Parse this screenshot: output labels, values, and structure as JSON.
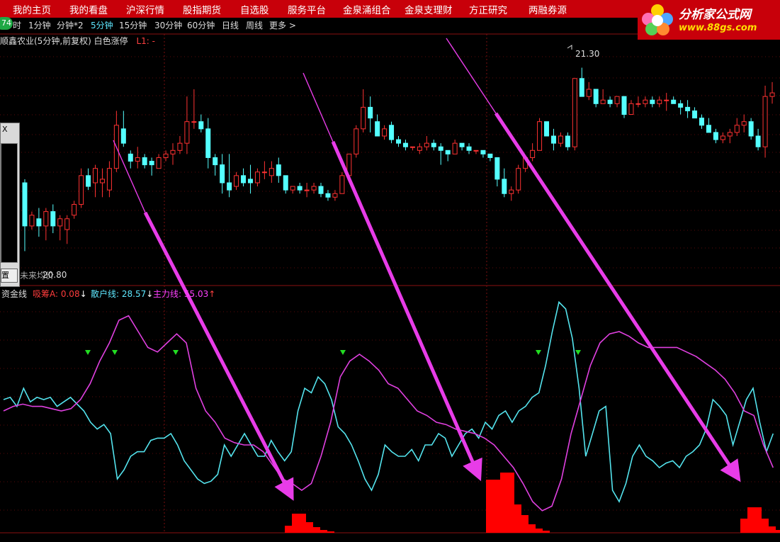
{
  "topnav": {
    "items": [
      "我的主页",
      "我的看盘",
      "沪深行情",
      "股指期货",
      "自选股",
      "服务平台",
      "金泉涌组合",
      "金泉支理财",
      "方正研究",
      "两融券源"
    ]
  },
  "logo": {
    "title": "分析家公式网",
    "url_text": "www.88gs.com"
  },
  "badge": "74",
  "periods": [
    "时",
    "1分钟",
    "分钟*2",
    "5分钟",
    "15分钟",
    "30分钟",
    "60分钟",
    "日线",
    "周线",
    "更多 >"
  ],
  "active_period": "5分钟",
  "stock": {
    "title": "顺鑫农业(5分钟,前复权) 白色涨停",
    "l1": "L1: -",
    "high_label": "21.30",
    "low_label": "20.80",
    "low_prefix": "未来均价"
  },
  "sidepanel": {
    "close": "X",
    "button": "置"
  },
  "indicator": {
    "name": "资金线",
    "items": [
      {
        "label": "吸筹A: 0.08",
        "arrow": "↓",
        "color": "#ff3c3c"
      },
      {
        "label": "散户线: 28.57",
        "arrow": "↓",
        "color": "#5ee8ff"
      },
      {
        "label": "主力线: 55.03",
        "arrow": "↑",
        "color": "#ff40ff"
      }
    ]
  },
  "colors": {
    "up": "#ff3232",
    "down": "#54ffff",
    "main": "#e040e0",
    "retail": "#54e4ee",
    "bars": "#ff0000",
    "arrow": "#e83ce8",
    "signal": "#22dd22"
  },
  "chart_data": [
    {
      "type": "candlestick",
      "title": "顺鑫农业(5分钟,前复权)",
      "ylim": [
        20.72,
        21.37
      ],
      "markers": {
        "high": 21.3,
        "low": 20.8
      },
      "candles": [
        [
          20.98,
          20.86,
          20.79,
          20.99
        ],
        [
          20.86,
          20.89,
          20.85,
          20.9
        ],
        [
          20.88,
          20.86,
          20.83,
          20.91
        ],
        [
          20.86,
          20.9,
          20.82,
          20.91
        ],
        [
          20.9,
          20.86,
          20.84,
          20.92
        ],
        [
          20.86,
          20.88,
          20.82,
          20.89
        ],
        [
          20.85,
          20.88,
          20.81,
          20.89
        ],
        [
          20.89,
          20.92,
          20.88,
          20.93
        ],
        [
          20.92,
          21.0,
          20.91,
          21.02
        ],
        [
          21.0,
          20.97,
          20.96,
          21.02
        ],
        [
          20.98,
          21.02,
          20.94,
          21.03
        ],
        [
          20.98,
          20.99,
          20.94,
          21.02
        ],
        [
          20.96,
          21.02,
          20.94,
          21.04
        ],
        [
          21.02,
          21.14,
          21.01,
          21.18
        ],
        [
          21.13,
          21.09,
          21.08,
          21.18
        ],
        [
          21.06,
          21.04,
          21.02,
          21.07
        ],
        [
          21.04,
          21.05,
          21.02,
          21.08
        ],
        [
          21.05,
          21.03,
          21.02,
          21.06
        ],
        [
          21.04,
          21.03,
          21.0,
          21.05
        ],
        [
          21.02,
          21.05,
          21.02,
          21.06
        ],
        [
          21.05,
          21.06,
          21.04,
          21.07
        ],
        [
          21.06,
          21.07,
          21.03,
          21.09
        ],
        [
          21.07,
          21.09,
          21.06,
          21.11
        ],
        [
          21.09,
          21.15,
          21.06,
          21.22
        ],
        [
          21.15,
          21.15,
          21.13,
          21.24
        ],
        [
          21.15,
          21.13,
          21.12,
          21.17
        ],
        [
          21.13,
          21.05,
          21.02,
          21.16
        ],
        [
          21.05,
          21.03,
          21.0,
          21.06
        ],
        [
          21.03,
          20.98,
          20.95,
          21.06
        ],
        [
          20.98,
          20.96,
          20.94,
          21.06
        ],
        [
          20.97,
          21.0,
          20.96,
          21.01
        ],
        [
          21.0,
          20.98,
          20.97,
          21.02
        ],
        [
          20.99,
          20.98,
          20.95,
          21.03
        ],
        [
          20.98,
          21.01,
          20.97,
          21.02
        ],
        [
          21.01,
          21.01,
          20.99,
          21.04
        ],
        [
          21.0,
          21.02,
          20.98,
          21.04
        ],
        [
          21.03,
          21.0,
          20.98,
          21.05
        ],
        [
          21.0,
          20.96,
          20.95,
          21.0
        ],
        [
          20.96,
          20.97,
          20.95,
          20.97
        ],
        [
          20.97,
          20.96,
          20.95,
          20.98
        ],
        [
          20.96,
          20.96,
          20.94,
          20.98
        ],
        [
          20.96,
          20.97,
          20.95,
          20.98
        ],
        [
          20.97,
          20.95,
          20.94,
          20.98
        ],
        [
          20.95,
          20.94,
          20.93,
          20.96
        ],
        [
          20.94,
          20.95,
          20.93,
          20.96
        ],
        [
          20.95,
          21.0,
          20.95,
          21.01
        ],
        [
          21.0,
          21.06,
          20.99,
          21.06
        ],
        [
          21.06,
          21.13,
          21.05,
          21.14
        ],
        [
          21.13,
          21.19,
          21.12,
          21.24
        ],
        [
          21.19,
          21.16,
          21.12,
          21.22
        ],
        [
          21.15,
          21.11,
          21.11,
          21.17
        ],
        [
          21.11,
          21.13,
          21.1,
          21.14
        ],
        [
          21.14,
          21.1,
          21.09,
          21.15
        ],
        [
          21.1,
          21.09,
          21.08,
          21.11
        ],
        [
          21.09,
          21.08,
          21.07,
          21.1
        ],
        [
          21.08,
          21.08,
          21.07,
          21.08
        ],
        [
          21.07,
          21.08,
          21.06,
          21.09
        ],
        [
          21.08,
          21.09,
          21.07,
          21.11
        ],
        [
          21.09,
          21.08,
          21.07,
          21.1
        ],
        [
          21.08,
          21.07,
          21.03,
          21.09
        ],
        [
          21.07,
          21.06,
          21.04,
          21.07
        ],
        [
          21.06,
          21.09,
          21.06,
          21.1
        ],
        [
          21.09,
          21.08,
          21.07,
          21.09
        ],
        [
          21.08,
          21.07,
          21.06,
          21.09
        ],
        [
          21.07,
          21.07,
          21.06,
          21.07
        ],
        [
          21.07,
          21.06,
          21.05,
          21.07
        ],
        [
          21.06,
          21.05,
          21.04,
          21.06
        ],
        [
          21.05,
          20.99,
          20.97,
          21.05
        ],
        [
          20.99,
          20.95,
          20.94,
          21.02
        ],
        [
          20.95,
          20.96,
          20.93,
          20.97
        ],
        [
          20.96,
          21.02,
          20.95,
          21.03
        ],
        [
          21.02,
          21.05,
          21.01,
          21.05
        ],
        [
          21.05,
          21.07,
          21.04,
          21.09
        ],
        [
          21.07,
          21.15,
          21.07,
          21.16
        ],
        [
          21.15,
          21.11,
          21.11,
          21.15
        ],
        [
          21.11,
          21.09,
          21.07,
          21.13
        ],
        [
          21.09,
          21.11,
          21.08,
          21.12
        ],
        [
          21.11,
          21.08,
          21.07,
          21.12
        ],
        [
          21.08,
          21.27,
          21.07,
          21.27
        ],
        [
          21.27,
          21.22,
          21.22,
          21.3
        ],
        [
          21.22,
          21.24,
          21.21,
          21.26
        ],
        [
          21.24,
          21.2,
          21.19,
          21.24
        ],
        [
          21.2,
          21.21,
          21.2,
          21.24
        ],
        [
          21.21,
          21.2,
          21.19,
          21.22
        ],
        [
          21.2,
          21.22,
          21.19,
          21.22
        ],
        [
          21.22,
          21.17,
          21.16,
          21.21
        ],
        [
          21.17,
          21.2,
          21.17,
          21.21
        ],
        [
          21.2,
          21.2,
          21.19,
          21.22
        ],
        [
          21.2,
          21.21,
          21.19,
          21.22
        ],
        [
          21.21,
          21.2,
          21.19,
          21.22
        ],
        [
          21.2,
          21.21,
          21.19,
          21.22
        ],
        [
          21.21,
          21.21,
          21.18,
          21.23
        ],
        [
          21.21,
          21.2,
          21.2,
          21.22
        ],
        [
          21.2,
          21.19,
          21.17,
          21.21
        ],
        [
          21.19,
          21.18,
          21.16,
          21.21
        ],
        [
          21.18,
          21.16,
          21.16,
          21.19
        ],
        [
          21.16,
          21.14,
          21.13,
          21.17
        ],
        [
          21.14,
          21.12,
          21.12,
          21.16
        ],
        [
          21.12,
          21.1,
          21.09,
          21.13
        ],
        [
          21.1,
          21.11,
          21.09,
          21.12
        ],
        [
          21.11,
          21.12,
          21.09,
          21.13
        ],
        [
          21.12,
          21.14,
          21.11,
          21.16
        ],
        [
          21.14,
          21.15,
          21.12,
          21.17
        ],
        [
          21.15,
          21.11,
          21.1,
          21.16
        ],
        [
          21.11,
          21.08,
          21.07,
          21.13
        ],
        [
          21.08,
          21.22,
          21.05,
          21.25
        ],
        [
          21.22,
          21.23,
          21.2,
          21.26
        ]
      ]
    },
    {
      "type": "line",
      "title": "资金线",
      "ylim": [
        0,
        100
      ],
      "series": [
        {
          "name": "散户线",
          "values": [
            55,
            56,
            52,
            60,
            54,
            56,
            55,
            56,
            52,
            54,
            56,
            53,
            50,
            45,
            42,
            44,
            40,
            20,
            24,
            30,
            32,
            32,
            37,
            38,
            38,
            40,
            35,
            28,
            24,
            20,
            18,
            19,
            22,
            35,
            30,
            35,
            40,
            35,
            30,
            30,
            37,
            32,
            28,
            32,
            50,
            60,
            58,
            65,
            62,
            55,
            43,
            40,
            35,
            28,
            20,
            15,
            22,
            35,
            32,
            30,
            30,
            33,
            28,
            35,
            35,
            40,
            38,
            30,
            35,
            40,
            42,
            38,
            45,
            42,
            48,
            50,
            45,
            50,
            52,
            56,
            58,
            70,
            85,
            98,
            95,
            82,
            60,
            30,
            40,
            50,
            52,
            15,
            10,
            18,
            30,
            35,
            30,
            28,
            25,
            27,
            28,
            25,
            30,
            32,
            35,
            42,
            55,
            52,
            48,
            35,
            45,
            55,
            60,
            45,
            32,
            40
          ]
        },
        {
          "name": "主力线",
          "values": [
            50,
            52,
            53,
            52,
            52,
            51,
            50,
            51,
            55,
            62,
            72,
            80,
            90,
            92,
            85,
            78,
            76,
            80,
            84,
            80,
            60,
            50,
            45,
            38,
            36,
            35,
            35,
            32,
            26,
            20,
            18,
            15,
            18,
            30,
            45,
            65,
            72,
            75,
            72,
            68,
            62,
            60,
            55,
            50,
            48,
            45,
            44,
            42,
            41,
            40,
            38,
            35,
            30,
            25,
            18,
            10,
            6,
            8,
            20,
            40,
            55,
            70,
            80,
            84,
            85,
            83,
            80,
            78,
            78,
            78,
            78,
            76,
            74,
            71,
            68,
            64,
            58,
            50,
            48,
            35,
            25
          ]
        },
        {
          "name": "吸筹A",
          "type": "bar",
          "values": [
            0,
            0,
            0,
            0,
            0,
            0,
            0,
            0,
            0,
            0,
            0,
            0,
            0,
            0,
            0,
            0,
            0,
            0,
            0,
            0,
            0,
            0,
            0,
            0,
            0,
            0,
            0,
            0,
            0,
            0,
            0,
            0,
            0,
            0,
            0,
            0,
            0,
            0,
            0,
            0,
            0,
            0,
            0,
            0,
            0,
            0,
            0,
            0,
            0,
            0,
            0,
            0,
            0,
            0,
            0,
            0,
            0,
            0,
            0,
            0,
            0,
            0,
            0,
            0,
            0,
            0,
            0,
            0,
            0,
            0,
            0,
            0,
            0,
            0,
            0,
            0,
            0,
            0,
            0,
            0,
            0,
            0,
            0,
            0,
            0,
            0,
            0,
            0,
            0,
            0,
            0,
            0,
            0,
            0,
            0,
            0,
            0,
            0,
            0,
            0,
            0,
            0,
            0,
            0,
            0,
            0,
            0,
            0,
            0,
            0,
            0,
            0,
            0,
            0,
            0,
            0
          ]
        }
      ]
    }
  ]
}
